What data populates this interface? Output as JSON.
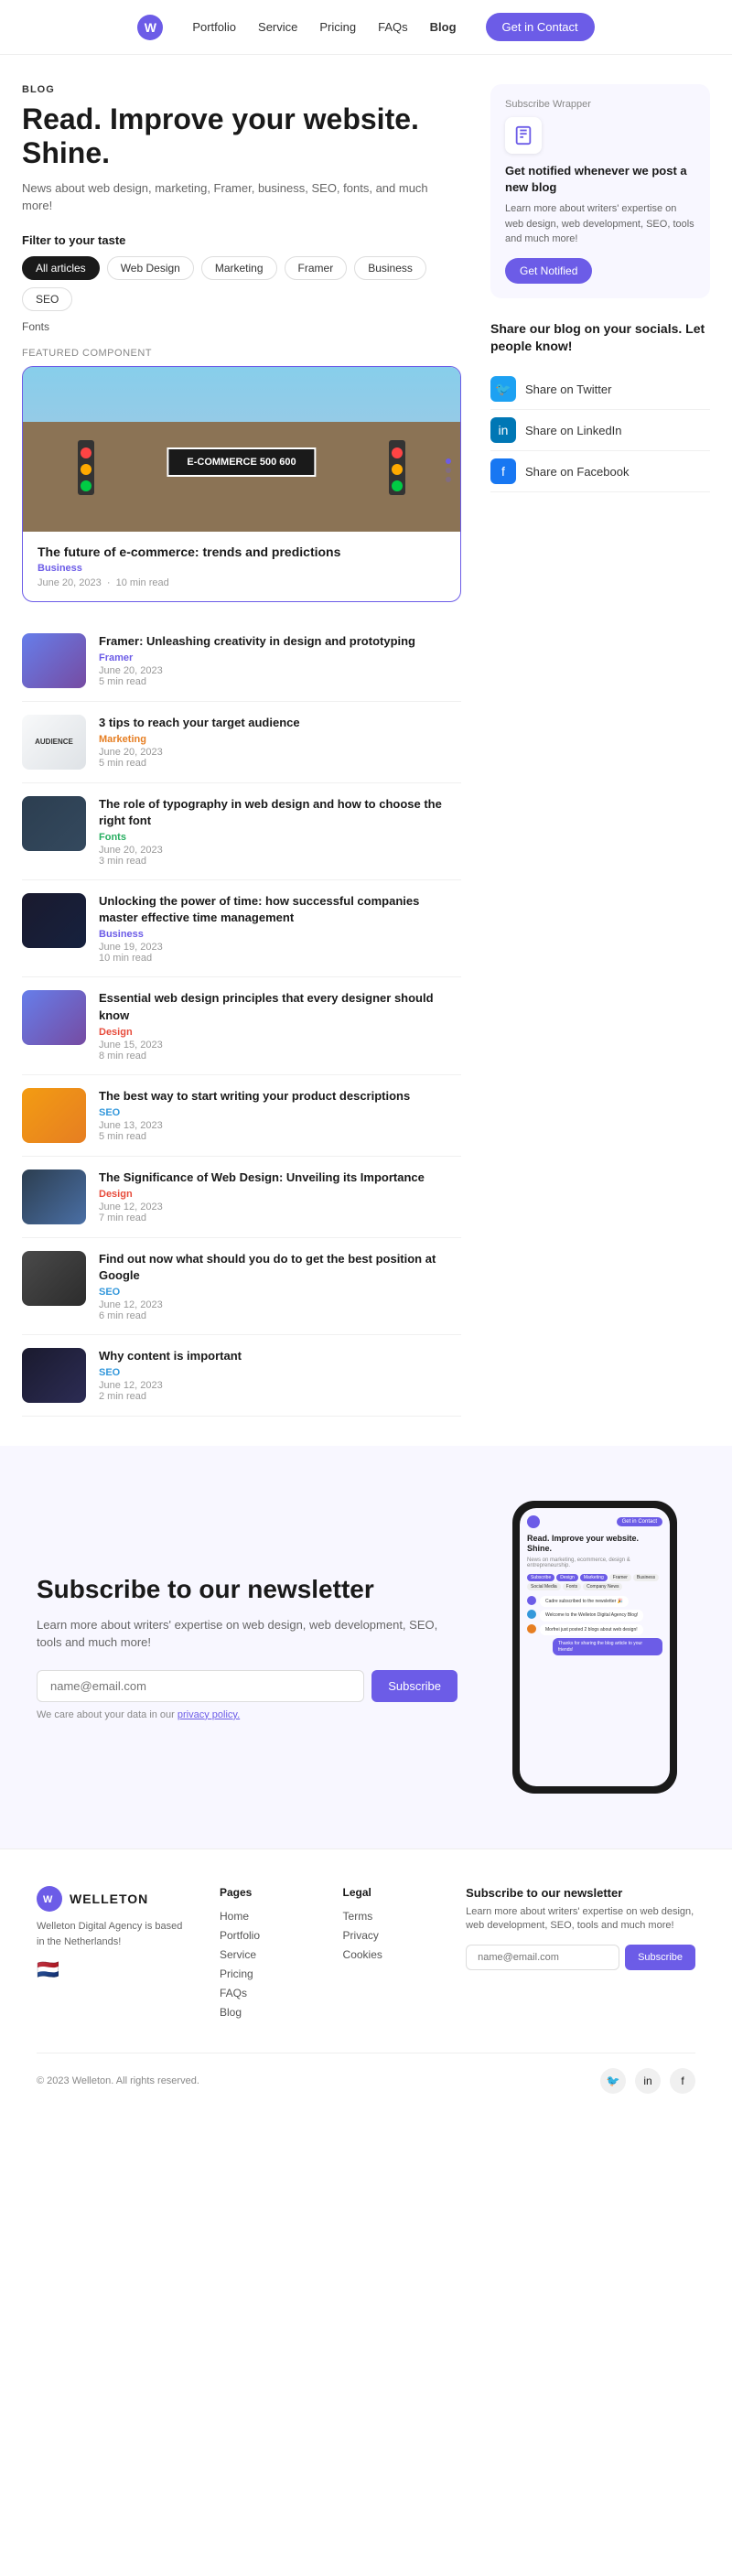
{
  "nav": {
    "logo": "W",
    "links": [
      "Portfolio",
      "Service",
      "Pricing",
      "FAQs",
      "Blog"
    ],
    "cta": "Get in Contact"
  },
  "blog": {
    "label": "BLOG",
    "title": "Read. Improve your website. Shine.",
    "description": "News about web design, marketing, Framer, business, SEO, fonts, and much more!",
    "filter": {
      "label": "Filter to your taste",
      "tags": [
        "All articles",
        "Web Design",
        "Marketing",
        "Framer",
        "Business",
        "SEO"
      ],
      "extra": "Fonts"
    }
  },
  "featured": {
    "label": "Featured Component",
    "title": "The future of e-commerce: trends and predictions",
    "category": "Business",
    "date": "June 20, 2023",
    "read_time": "10 min read",
    "sign_text": "E-COMMERCE 500   600"
  },
  "posts": [
    {
      "title": "Framer: Unleashing creativity in design and prototyping",
      "category": "Framer",
      "cat_class": "cat-framer",
      "date": "June 20, 2023",
      "read_time": "5 min read",
      "thumb_class": "thumb-framer"
    },
    {
      "title": "3 tips to reach your target audience",
      "category": "Marketing",
      "cat_class": "cat-marketing",
      "date": "June 20, 2023",
      "read_time": "5 min read",
      "thumb_class": "thumb-audience"
    },
    {
      "title": "The role of typography in web design and how to choose the right font",
      "category": "Fonts",
      "cat_class": "cat-fonts",
      "date": "June 20, 2023",
      "read_time": "3 min read",
      "thumb_class": "thumb-typography"
    },
    {
      "title": "Unlocking the power of time: how successful companies master effective time management",
      "category": "Business",
      "cat_class": "cat-business",
      "date": "June 19, 2023",
      "read_time": "10 min read",
      "thumb_class": "thumb-time"
    },
    {
      "title": "Essential web design principles that every designer should know",
      "category": "Design",
      "cat_class": "cat-design",
      "date": "June 15, 2023",
      "read_time": "8 min read",
      "thumb_class": "thumb-webdesign"
    },
    {
      "title": "The best way to start writing your product descriptions",
      "category": "SEO",
      "cat_class": "cat-seo",
      "date": "June 13, 2023",
      "read_time": "5 min read",
      "thumb_class": "thumb-open"
    },
    {
      "title": "The Significance of Web Design: Unveiling its Importance",
      "category": "Design",
      "cat_class": "cat-design",
      "date": "June 12, 2023",
      "read_time": "7 min read",
      "thumb_class": "thumb-significance"
    },
    {
      "title": "Find out now what should you do to get the best position at Google",
      "category": "SEO",
      "cat_class": "cat-seo",
      "date": "June 12, 2023",
      "read_time": "6 min read",
      "thumb_class": "thumb-google"
    },
    {
      "title": "Why content is important",
      "category": "SEO",
      "cat_class": "cat-seo",
      "date": "June 12, 2023",
      "read_time": "2 min read",
      "thumb_class": "thumb-content"
    }
  ],
  "sidebar": {
    "subscribe_wrapper": "Subscribe Wrapper",
    "subscribe_title": "Get notified whenever we post a new blog",
    "subscribe_desc": "Learn more about writers' expertise on web design, web development, SEO, tools and much more!",
    "notify_btn": "Get Notified",
    "share_title": "Share our blog on your socials. Let people know!",
    "share_items": [
      {
        "label": "Share on Twitter",
        "icon": "🐦",
        "icon_class": "twitter"
      },
      {
        "label": "Share on LinkedIn",
        "icon": "in",
        "icon_class": "linkedin"
      },
      {
        "label": "Share on Facebook",
        "icon": "f",
        "icon_class": "facebook"
      }
    ]
  },
  "subscribe_section": {
    "title": "Subscribe to our newsletter",
    "description": "Learn more about writers' expertise on web design, web development, SEO, tools and much more!",
    "input_placeholder": "name@email.com",
    "btn_label": "Subscribe",
    "privacy_text": "We care about your data in our",
    "privacy_link": "privacy policy.",
    "phone": {
      "nav_btn": "Get in Contact",
      "title": "Read. Improve your website. Shine.",
      "subtitle": "News on marketing, ecommerce, design & entrepreneurship.",
      "tags": [
        "Subscribe",
        "Design",
        "Marketing",
        "Framer",
        "Business",
        "Social Media",
        "Fonts",
        "Company News"
      ],
      "chats": [
        {
          "text": "Cadre subscribed to the newsletter 🎉",
          "sent": false,
          "color": "#6c5ce7"
        },
        {
          "text": "Welcome to the Welleton Digital Agency Blog!",
          "sent": false,
          "color": "#3498db"
        },
        {
          "text": "Morfrei just posted 2 blogs about web design!",
          "sent": false,
          "color": "#e67e22"
        },
        {
          "text": "Thanks for sharing the blog article to your friends!",
          "sent": true,
          "color": "#6c5ce7"
        }
      ]
    }
  },
  "footer": {
    "logo_text": "WELLETON",
    "brand_desc": "Welleton Digital Agency is based in the Netherlands!",
    "flag": "🇳🇱",
    "pages": {
      "title": "Pages",
      "links": [
        "Home",
        "Portfolio",
        "Service",
        "Pricing",
        "FAQs",
        "Blog"
      ]
    },
    "legal": {
      "title": "Legal",
      "links": [
        "Terms",
        "Privacy",
        "Cookies"
      ]
    },
    "newsletter": {
      "title": "Subscribe to our newsletter",
      "desc": "Learn more about writers' expertise on web design, web development, SEO, tools and much more!",
      "input_placeholder": "name@email.com",
      "btn_label": "Subscribe"
    },
    "copyright": "© 2023 Welleton. All rights reserved.",
    "socials": [
      "🐦",
      "in",
      "f"
    ]
  }
}
